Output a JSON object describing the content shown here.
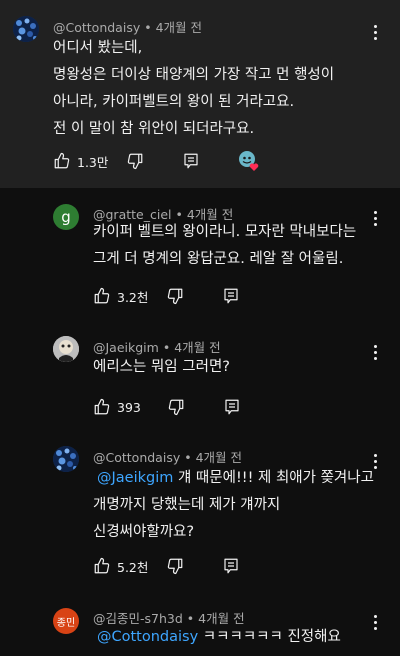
{
  "comments": [
    {
      "author": "@Cottondaisy",
      "time": "4개월 전",
      "lines": [
        "어디서 봤는데,",
        "명왕성은 더이상 태양계의 가장 작고 먼 행성이",
        "아니라, 카이퍼벨트의 왕이 된 거라고요.",
        "전 이 말이 참 위안이 되더라구요."
      ],
      "likes": "1.3만"
    },
    {
      "author": "@gratte_ciel",
      "time": "4개월 전",
      "avatar_letter": "g",
      "lines": [
        "카이퍼 벨트의 왕이라니. 모자란 막내보다는",
        "그게 더 명계의 왕답군요. 레알 잘 어울림."
      ],
      "likes": "3.2천"
    },
    {
      "author": "@Jaeikgim",
      "time": "4개월 전",
      "lines": [
        "에리스는 뭐임 그러면?"
      ],
      "likes": "393"
    },
    {
      "author": "@Cottondaisy",
      "time": "4개월 전",
      "mention": "@Jaeikgim",
      "lines": [
        " 걔 때문에!!! 제 최애가 쫒겨나고",
        "개명까지 당했는데 제가 걔까지",
        "신경써야할까요?"
      ],
      "likes": "5.2천"
    },
    {
      "author": "@김종민-s7h3d",
      "time": "4개월 전",
      "avatar_letter": "종민",
      "mention": "@Cottondaisy",
      "lines": [
        " ㅋㅋㅋㅋㅋㅋ 진정해요"
      ]
    }
  ],
  "colors": {
    "background": "#0f0f0f",
    "highlight": "#212121",
    "mention": "#3ea6ff",
    "gratte_avatar": "#2e7d32",
    "kim_avatar": "#d84315"
  }
}
